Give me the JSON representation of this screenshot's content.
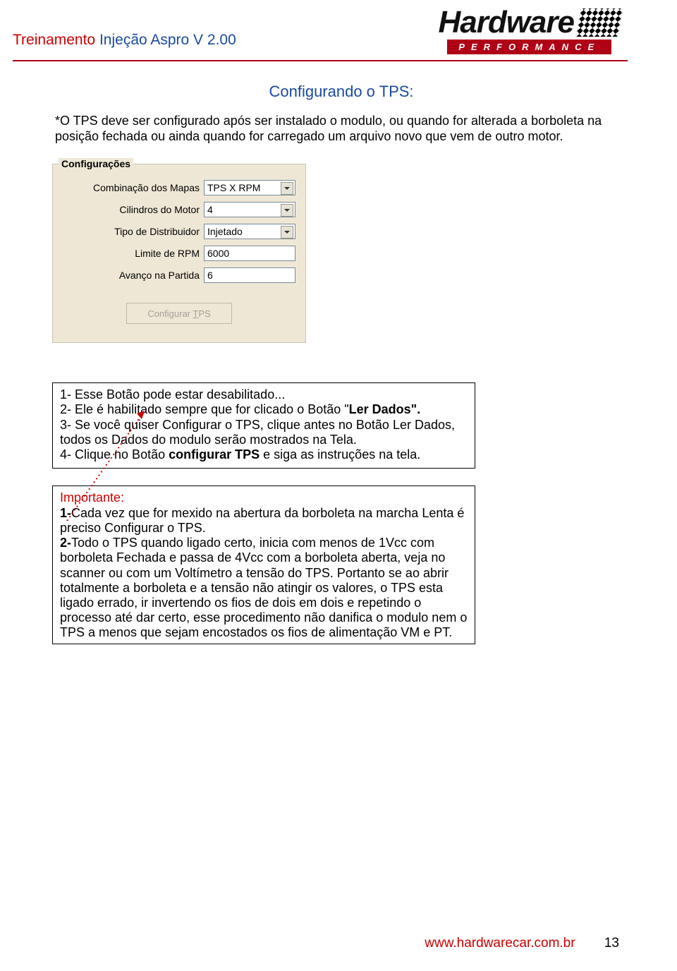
{
  "header": {
    "title_prefix": "Treinamento",
    "title_main": "Injeção Aspro  V 2.00",
    "logo_text": "Hardware",
    "logo_sub": "PERFORMANCE"
  },
  "section": {
    "title": "Configurando o TPS:",
    "intro": "*O TPS deve ser configurado após ser instalado o modulo, ou quando for alterada a borboleta na posição fechada ou ainda quando for carregado um arquivo novo que vem de outro motor."
  },
  "panel": {
    "legend": "Configurações",
    "fields": {
      "combinacao": {
        "label": "Combinação dos Mapas",
        "value": "TPS X RPM"
      },
      "cilindros": {
        "label": "Cilindros do Motor",
        "value": "4"
      },
      "distribuidor": {
        "label": "Tipo de Distribuidor",
        "value": "Injetado"
      },
      "limite": {
        "label": "Limite de RPM",
        "value": "6000"
      },
      "avanco": {
        "label": "Avanço na Partida",
        "value": "6"
      }
    },
    "button_text": "Configurar TPS"
  },
  "notes": {
    "l1": "1- Esse Botão pode estar desabilitado...",
    "l2a": "2- Ele é habilitado sempre que for clicado o Botão \"",
    "l2b": "Ler Dados\".",
    "l3": "3- Se você quiser Configurar o TPS, clique antes no Botão Ler Dados, todos os Dados do modulo serão mostrados na Tela.",
    "l4a": "4- Clique no Botão ",
    "l4b": "configurar TPS",
    "l4c": " e siga as instruções na tela."
  },
  "important": {
    "title": "Importante:",
    "p1a": " 1-",
    "p1b": "Cada vez que for mexido na abertura da borboleta na marcha Lenta é preciso Configurar o TPS.",
    "p2a": "2-",
    "p2b": "Todo o TPS quando ligado certo, inicia com menos de 1Vcc com borboleta Fechada e passa de 4Vcc com a borboleta aberta, veja no scanner ou com um Voltímetro a tensão do TPS. Portanto se ao abrir totalmente a borboleta  e a tensão não atingir os valores, o TPS esta ligado errado, ir invertendo os fios de dois em dois e repetindo o processo até dar certo, esse procedimento não danifica o modulo nem o TPS a menos que sejam encostados os fios de alimentação VM e PT."
  },
  "footer": {
    "url": "www.hardwarecar.com.br",
    "page": "13"
  }
}
